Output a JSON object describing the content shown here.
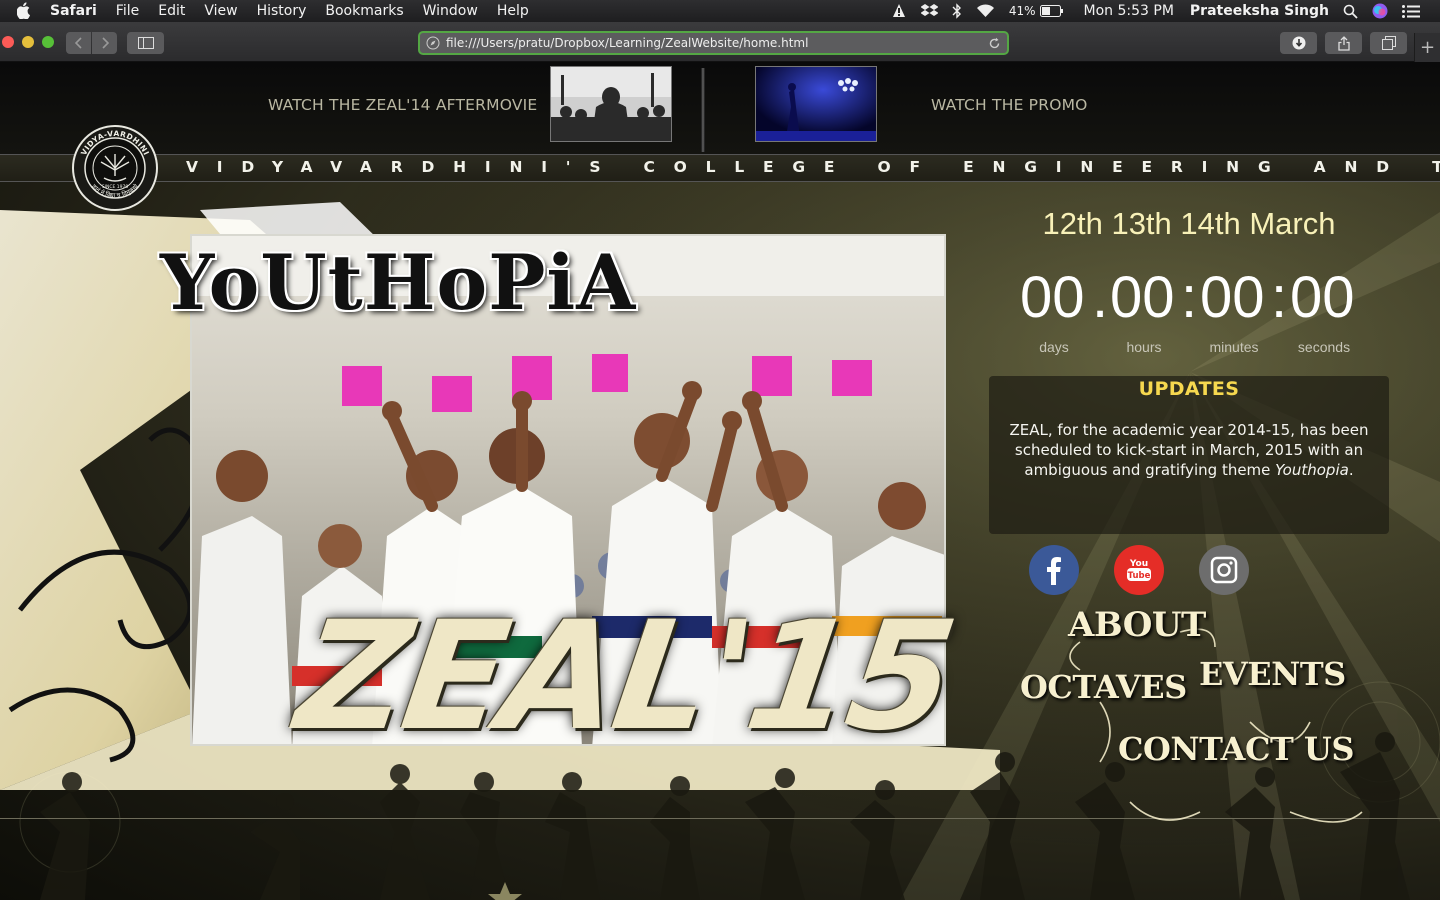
{
  "menubar": {
    "app_name": "Safari",
    "items": [
      "File",
      "Edit",
      "View",
      "History",
      "Bookmarks",
      "Window",
      "Help"
    ],
    "battery": "41%",
    "clock": "Mon 5:53 PM",
    "user": "Prateeksha Singh"
  },
  "browser": {
    "url": "file:///Users/pratu/Dropbox/Learning/ZealWebsite/home.html"
  },
  "header": {
    "aftermovie_link": "WATCH THE ZEAL'14 AFTERMOVIE",
    "promo_link": "WATCH THE PROMO",
    "college_name": "VIDYAVARDHINI'S COLLEGE OF ENGINEERING AND TECHNOLOGY",
    "logo_ring_top": "VIDYA-VARDHINI",
    "logo_ring_bottom": "ज्ञानं मे विद्या च विमुक्तये",
    "logo_inner": "SINCE 1970"
  },
  "hero": {
    "theme_title": "YoUtHoPiA",
    "event_title": "ZEAL'15"
  },
  "countdown": {
    "date": "12th 13th 14th March",
    "days": "00",
    "hours": "00",
    "minutes": "00",
    "seconds": "00",
    "label_days": "days",
    "label_hours": "hours",
    "label_minutes": "minutes",
    "label_seconds": "seconds"
  },
  "updates": {
    "title": "UPDATES",
    "text_before": "ZEAL, for the academic year 2014-15, has been scheduled to kick-start in March, 2015 with an ambiguous and gratifying theme ",
    "text_em": "Youthopia",
    "text_after": "."
  },
  "social": {
    "facebook_icon": "facebook-icon",
    "youtube_label": "You Tube",
    "instagram_icon": "instagram-icon",
    "colors": {
      "facebook": "#3b5998",
      "youtube": "#e52d27",
      "instagram": "#6d6d6d"
    }
  },
  "nav": {
    "about": "ABOUT",
    "octaves": "OCTAVES",
    "events": "EVENTS",
    "contact": "CONTACT US"
  },
  "colors": {
    "date_yellow": "#f8f1b8",
    "updates_title": "#f6d84f",
    "url_focus": "#54a744"
  }
}
